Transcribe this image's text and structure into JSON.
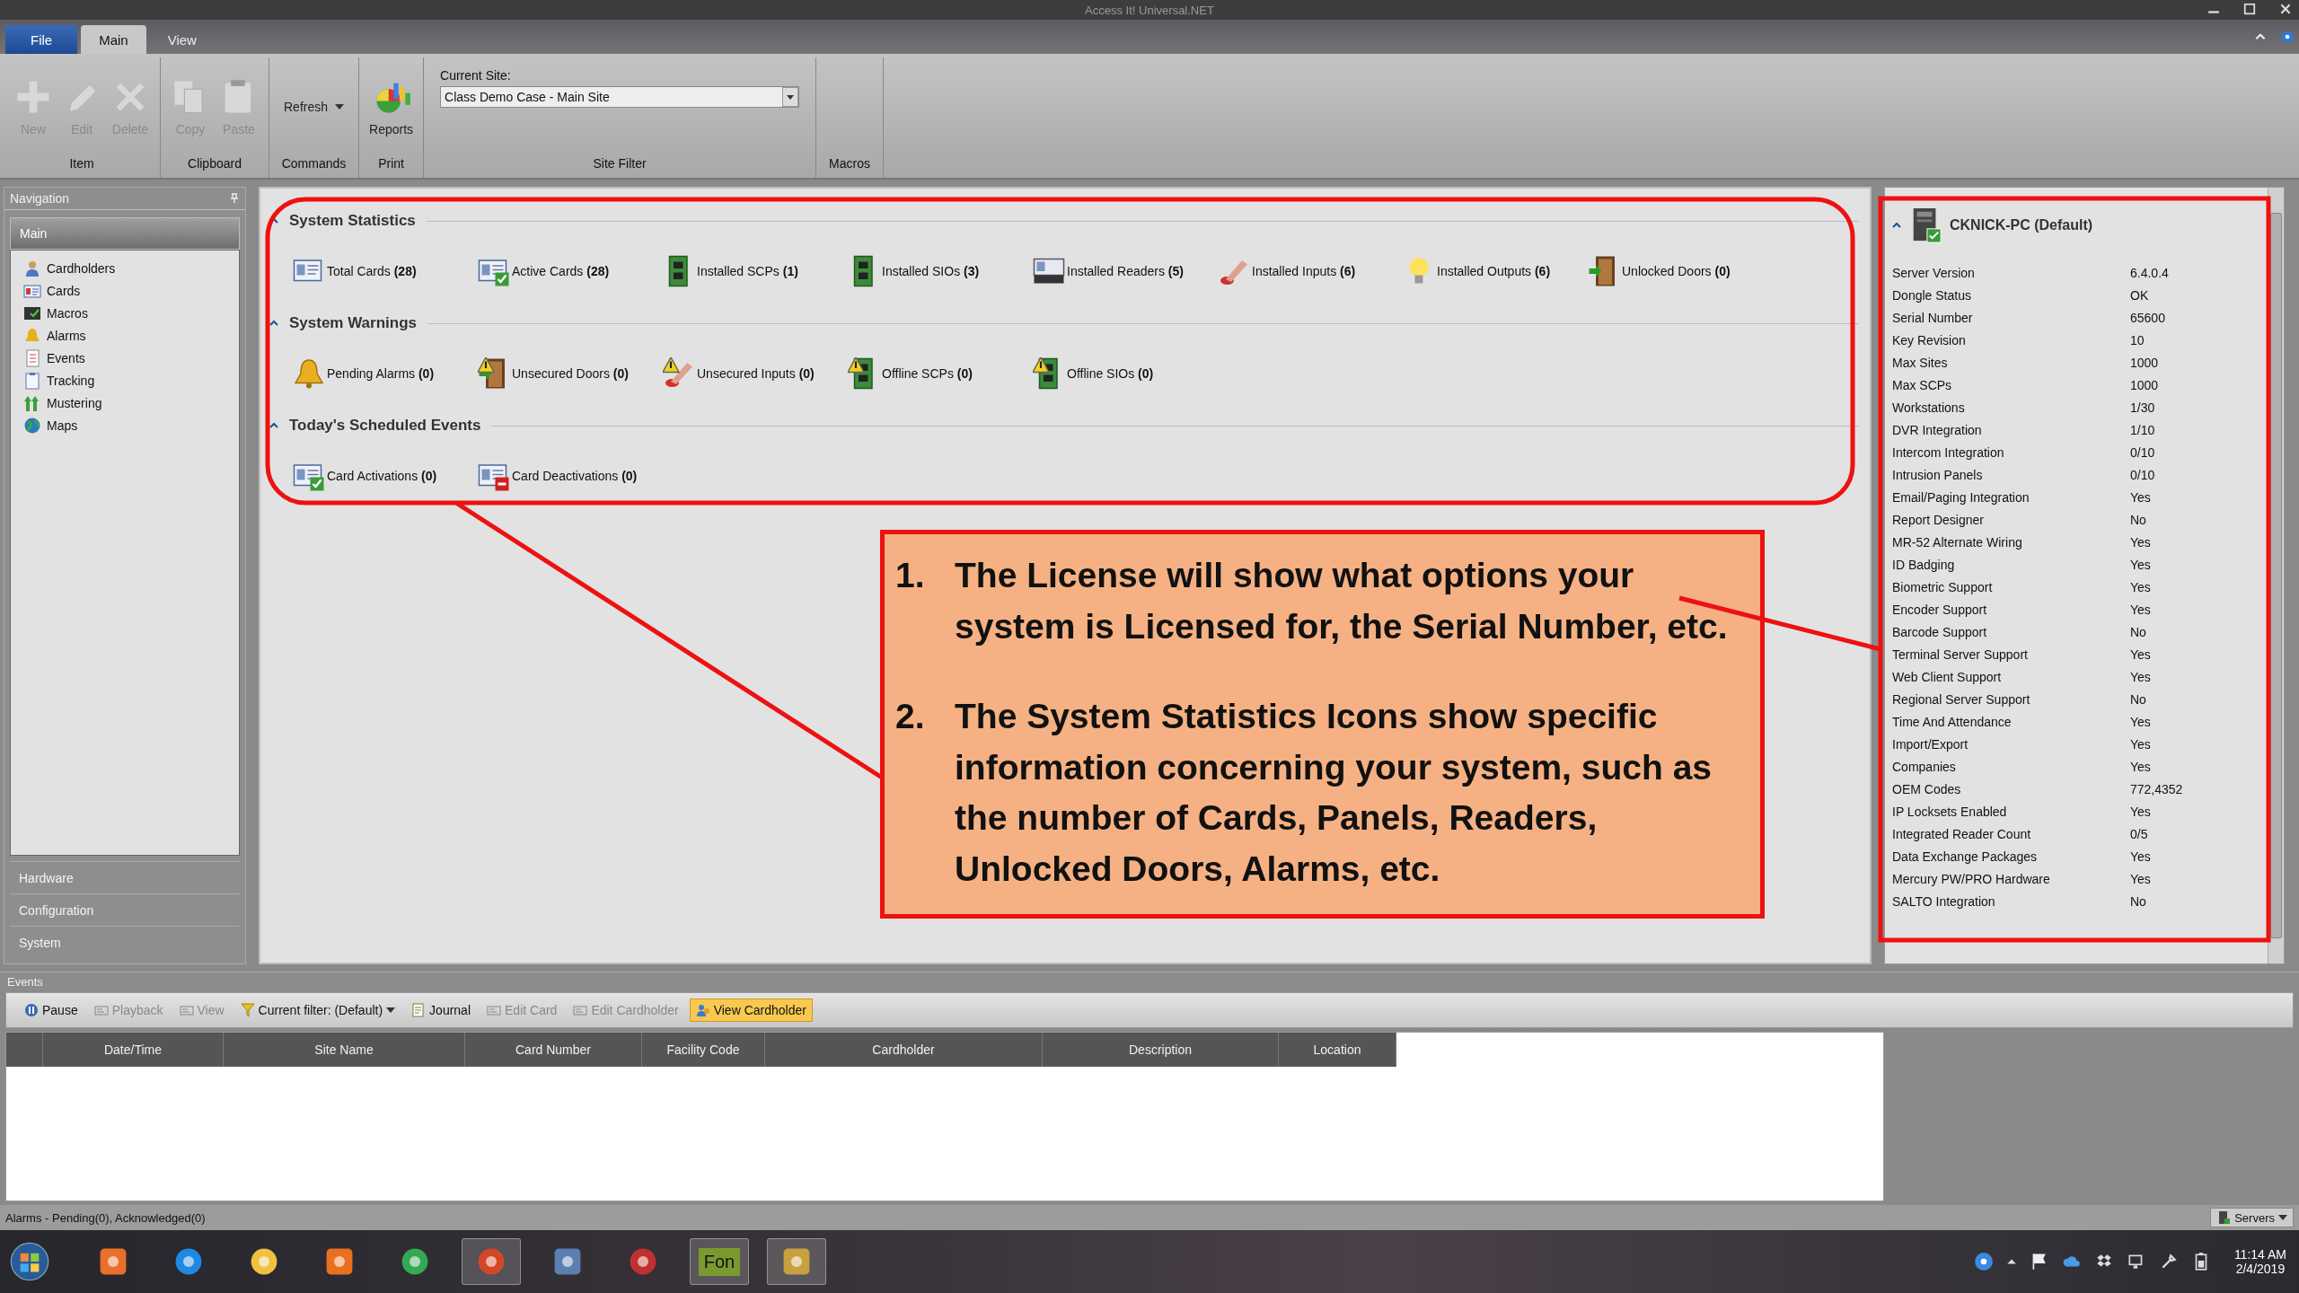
{
  "window": {
    "title": "Access It! Universal.NET"
  },
  "ribbon": {
    "tabs": [
      {
        "label": "File",
        "kind": "file",
        "selected": false
      },
      {
        "label": "Main",
        "kind": "tab",
        "selected": true
      },
      {
        "label": "View",
        "kind": "tab",
        "selected": false
      }
    ],
    "groups": [
      {
        "label": "Item",
        "buttons": [
          {
            "label": "New",
            "kind": "large",
            "disabled": true
          },
          {
            "label": "Edit",
            "kind": "large",
            "disabled": true
          },
          {
            "label": "Delete",
            "kind": "large",
            "disabled": true
          }
        ]
      },
      {
        "label": "Clipboard",
        "buttons": [
          {
            "label": "Copy",
            "kind": "large",
            "disabled": true
          },
          {
            "label": "Paste",
            "kind": "large",
            "disabled": true
          }
        ]
      },
      {
        "label": "Commands",
        "buttons": [
          {
            "label": "Refresh",
            "kind": "menu",
            "disabled": false
          }
        ]
      },
      {
        "label": "Print",
        "buttons": [
          {
            "label": "Reports",
            "kind": "large",
            "disabled": false
          }
        ]
      },
      {
        "label": "Site Filter",
        "field": {
          "label": "Current Site:",
          "value": "Class Demo Case - Main Site"
        }
      },
      {
        "label": "Macros"
      }
    ]
  },
  "navigation": {
    "title": "Navigation",
    "sections": [
      {
        "label": "Main",
        "expanded": true,
        "items": [
          "Cardholders",
          "Cards",
          "Macros",
          "Alarms",
          "Events",
          "Tracking",
          "Mustering",
          "Maps"
        ]
      },
      {
        "label": "Hardware",
        "expanded": false
      },
      {
        "label": "Configuration",
        "expanded": false
      },
      {
        "label": "System",
        "expanded": false
      }
    ]
  },
  "dashboard": {
    "sections": [
      {
        "title": "System Statistics",
        "expanded": true,
        "items": [
          "Total Cards **(28)**",
          "Active Cards **(28)**",
          "Installed SCPs **(1)**",
          "Installed SIOs **(3)**",
          "Installed Readers **(5)**",
          "Installed Inputs **(6)**",
          "Installed Outputs **(6)**",
          "Unlocked Doors **(0)**"
        ]
      },
      {
        "title": "System Warnings",
        "expanded": true,
        "items": [
          "Pending Alarms **(0)**",
          "Unsecured Doors **(0)**",
          "Unsecured Inputs **(0)**",
          "Offline SCPs **(0)**",
          "Offline SIOs **(0)**"
        ]
      },
      {
        "title": "Today's Scheduled Events",
        "expanded": true,
        "items": [
          "Card Activations **(0)**",
          "Card Deactivations **(0)**"
        ]
      }
    ]
  },
  "license": {
    "server": "CKNICK-PC (Default)",
    "expanded": true,
    "rows": [
      {
        "label": "Server Version",
        "value": "6.4.0.4"
      },
      {
        "label": "Dongle Status",
        "value": "OK"
      },
      {
        "label": "Serial Number",
        "value": "65600"
      },
      {
        "label": "Key Revision",
        "value": "10"
      },
      {
        "label": "Max Sites",
        "value": "1000"
      },
      {
        "label": "Max SCPs",
        "value": "1000"
      },
      {
        "label": "Workstations",
        "value": "1/30"
      },
      {
        "label": "DVR Integration",
        "value": "1/10"
      },
      {
        "label": "Intercom Integration",
        "value": "0/10"
      },
      {
        "label": "Intrusion Panels",
        "value": "0/10"
      },
      {
        "label": "Email/Paging Integration",
        "value": "Yes"
      },
      {
        "label": "Report Designer",
        "value": "No"
      },
      {
        "label": "MR-52 Alternate Wiring",
        "value": "Yes"
      },
      {
        "label": "ID Badging",
        "value": "Yes"
      },
      {
        "label": "Biometric Support",
        "value": "Yes"
      },
      {
        "label": "Encoder Support",
        "value": "Yes"
      },
      {
        "label": "Barcode Support",
        "value": "No"
      },
      {
        "label": "Terminal Server Support",
        "value": "Yes"
      },
      {
        "label": "Web Client Support",
        "value": "Yes"
      },
      {
        "label": "Regional Server Support",
        "value": "No"
      },
      {
        "label": "Time And Attendance",
        "value": "Yes"
      },
      {
        "label": "Import/Export",
        "value": "Yes"
      },
      {
        "label": "Companies",
        "value": "Yes"
      },
      {
        "label": "OEM Codes",
        "value": "772,4352"
      },
      {
        "label": "IP Locksets Enabled",
        "value": "Yes"
      },
      {
        "label": "Integrated Reader Count",
        "value": "0/5"
      },
      {
        "label": "Data Exchange Packages",
        "value": "Yes"
      },
      {
        "label": "Mercury PW/PRO Hardware",
        "value": "Yes"
      },
      {
        "label": "SALTO Integration",
        "value": "No"
      }
    ]
  },
  "events": {
    "title": "Events",
    "toolbar": [
      {
        "label": "Pause",
        "kind": "button",
        "disabled": false,
        "selected": false
      },
      {
        "label": "Playback",
        "kind": "button",
        "disabled": true,
        "selected": false
      },
      {
        "label": "View",
        "kind": "button",
        "disabled": true,
        "selected": false
      },
      {
        "label": "Current filter:  (Default)",
        "kind": "dropdown",
        "disabled": false,
        "selected": false
      },
      {
        "label": "Journal",
        "kind": "button",
        "disabled": false,
        "selected": false
      },
      {
        "label": "Edit Card",
        "kind": "button",
        "disabled": true,
        "selected": false
      },
      {
        "label": "Edit Cardholder",
        "kind": "button",
        "disabled": true,
        "selected": false
      },
      {
        "label": "View Cardholder",
        "kind": "button",
        "disabled": false,
        "selected": true
      }
    ],
    "columns": [
      "Date/Time",
      "Site Name",
      "Card Number",
      "Facility Code",
      "Cardholder",
      "Description",
      "Location"
    ]
  },
  "status_bar": {
    "text": "Alarms - Pending(0), Acknowledged(0)",
    "servers": "Servers"
  },
  "annotation": {
    "items": [
      {
        "number": "1.",
        "text": "The License will show what options your system is Licensed for, the Serial Number, etc."
      },
      {
        "number": "2.",
        "text": "The System Statistics Icons show specific information concerning your system, such as the number of Cards, Panels, Readers, Unlocked Doors, Alarms, etc."
      }
    ]
  },
  "taskbar": {
    "apps": [
      {
        "active": false
      },
      {
        "active": false
      },
      {
        "active": false
      },
      {
        "active": false
      },
      {
        "active": false
      },
      {
        "active": true
      },
      {
        "active": false
      },
      {
        "active": false
      },
      {
        "label": "Fon",
        "active": true
      },
      {
        "active": true
      }
    ],
    "time": "11:14 AM",
    "date": "2/4/2019"
  }
}
